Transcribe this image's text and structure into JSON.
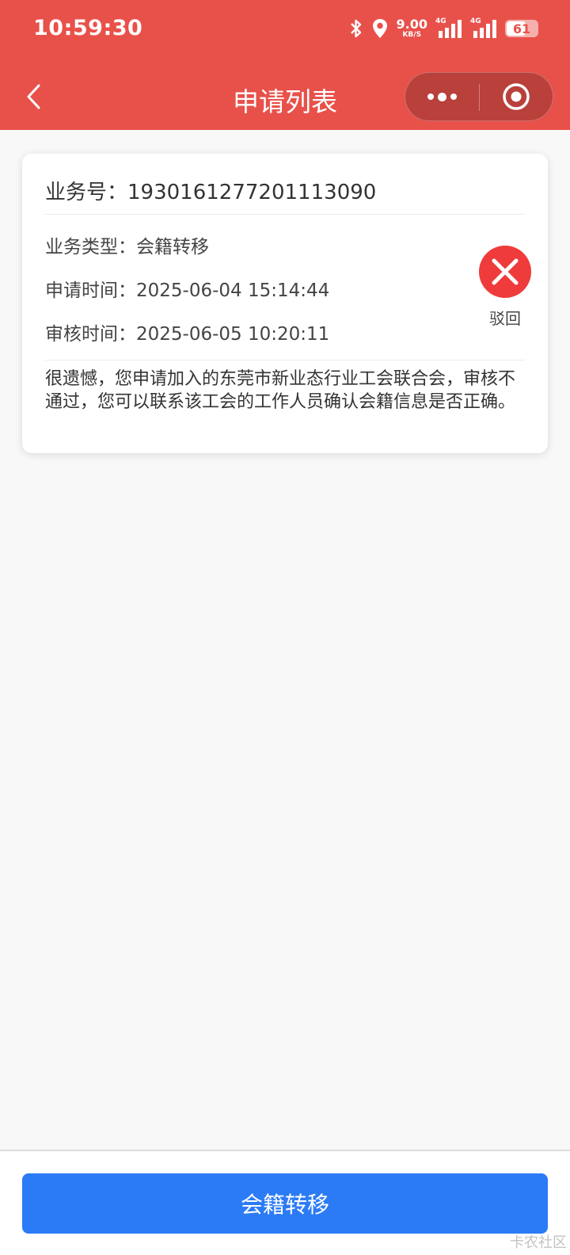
{
  "status_bar": {
    "time": "10:59:30",
    "net_speed_value": "9.00",
    "net_speed_unit": "KB/S",
    "signal1_label": "4G",
    "signal2_label": "4G",
    "battery_percent": "61",
    "icons": [
      "bluetooth-icon",
      "location-icon",
      "signal-icon",
      "battery-icon"
    ]
  },
  "nav": {
    "title": "申请列表"
  },
  "record": {
    "id_label": "业务号：",
    "id_value": "1930161277201113090",
    "type_label": "业务类型：",
    "type_value": "会籍转移",
    "apply_time_label": "申请时间：",
    "apply_time_value": "2025-06-04 15:14:44",
    "review_time_label": "审核时间：",
    "review_time_value": "2025-06-05 10:20:11",
    "status_label": "驳回",
    "message": "很遗憾，您申请加入的东莞市新业态行业工会联合会，审核不通过，您可以联系该工会的工作人员确认会籍信息是否正确。"
  },
  "bottom": {
    "button_label": "会籍转移"
  },
  "watermark": "卡农社区",
  "colors": {
    "header": "#e8514a",
    "primary": "#2c7bf6",
    "reject": "#ef3b3b",
    "background": "#f8f8f8"
  }
}
